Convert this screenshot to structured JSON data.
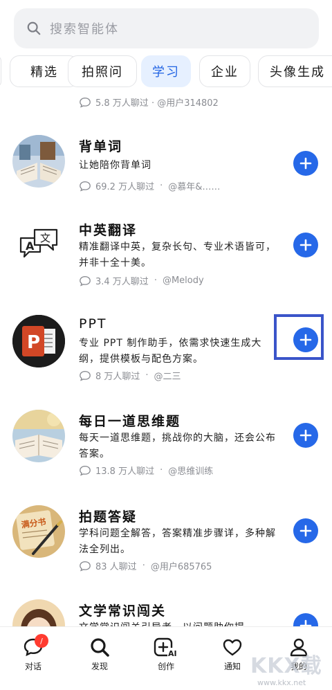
{
  "search": {
    "placeholder": "搜索智能体"
  },
  "tabs": [
    {
      "label": "精选",
      "active": false
    },
    {
      "label": "拍照问",
      "active": false
    },
    {
      "label": "学习",
      "active": true
    },
    {
      "label": "企业",
      "active": false
    },
    {
      "label": "头像生成",
      "active": false
    }
  ],
  "clipped_item": {
    "stats": "5.8 万人聊过 · @用户314802"
  },
  "items": [
    {
      "title": "背单词",
      "desc": "让她陪你背单词",
      "count": "69.2 万人聊过",
      "author": "@慕年&……",
      "icon": "open-book-avatar"
    },
    {
      "title": "中英翻译",
      "desc": "精准翻译中英，复杂长句、专业术语皆可，并非十全十美。",
      "count": "3.4 万人聊过",
      "author": "@Melody",
      "icon": "translate-icon"
    },
    {
      "title": "PPT",
      "desc": "专业 PPT 制作助手，依需求快速生成大纲，提供模板与配色方案。",
      "count": "8 万人聊过",
      "author": "@二三",
      "icon": "powerpoint-icon"
    },
    {
      "title": "每日一道思维题",
      "desc": "每天一道思维题，挑战你的大脑，还会公布答案。",
      "count": "13.8 万人聊过",
      "author": "@思维训练",
      "icon": "notebook-avatar"
    },
    {
      "title": "拍题答疑",
      "desc": "学科问题全解答，答案精准步骤详，多种解法全列出。",
      "count": "83 人聊过",
      "author": "@用户685765",
      "icon": "study-avatar"
    },
    {
      "title": "文学常识闯关",
      "desc": "文学常识闯关引导者，以问题助你提",
      "count": "",
      "author": "",
      "icon": "girl-avatar"
    }
  ],
  "bottom_nav": [
    {
      "label": "对话",
      "icon": "chat-icon",
      "badge": "/"
    },
    {
      "label": "发现",
      "icon": "search-icon"
    },
    {
      "label": "创作",
      "icon": "ai-create-icon"
    },
    {
      "label": "通知",
      "icon": "heart-icon"
    },
    {
      "label": "我的",
      "icon": "user-icon"
    }
  ],
  "watermark": {
    "text": "KKX载",
    "url": "www.kkx.net"
  },
  "colors": {
    "accent": "#2668e8",
    "active_tab_bg": "#e6f0ff",
    "highlight_box": "#3a54c9"
  }
}
